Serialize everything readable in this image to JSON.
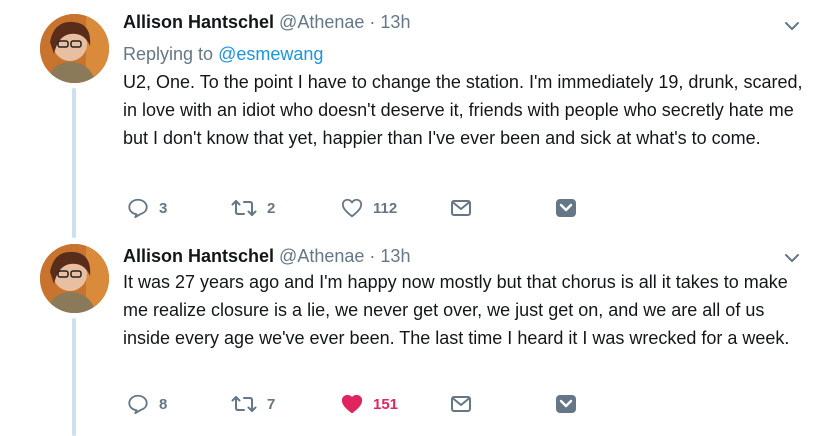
{
  "tweets": [
    {
      "author_name": "Allison Hantschel",
      "author_handle": "@Athenae",
      "separator": "·",
      "time": "13h",
      "replying_prefix": "Replying to",
      "replying_to": "@esmewang",
      "text": "U2, One. To the point I have to change the station. I'm immediately 19, drunk, scared, in love with an idiot who doesn't deserve it, friends with people who secretly hate me but I don't know that yet, happier than I've ever been and sick at what's to come.",
      "replies": "3",
      "retweets": "2",
      "likes": "112",
      "liked": false
    },
    {
      "author_name": "Allison Hantschel",
      "author_handle": "@Athenae",
      "separator": "·",
      "time": "13h",
      "text": "It was 27 years ago and I'm happy now mostly but that chorus is all it takes to make me realize closure is a lie, we never get over, we just get on, and we are all of us inside every age we've ever been. The last time I heard it I was wrecked for a week.",
      "replies": "8",
      "retweets": "7",
      "likes": "151",
      "liked": true
    }
  ],
  "colors": {
    "text": "#14171a",
    "muted": "#657786",
    "link": "#1b95e0",
    "like": "#e0245e",
    "thread_line": "#cce0f0"
  },
  "icons": [
    "reply-icon",
    "retweet-icon",
    "heart-icon",
    "message-icon",
    "share-icon",
    "chevron-down-icon"
  ]
}
